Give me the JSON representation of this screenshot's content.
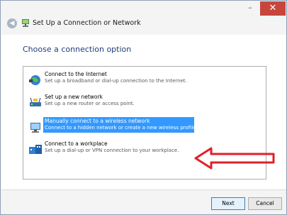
{
  "window": {
    "title": "Set Up a Connection or Network",
    "minimize_symbol": "–",
    "close_symbol": "✕"
  },
  "main": {
    "heading": "Choose a connection option",
    "options": [
      {
        "title": "Connect to the Internet",
        "description": "Set up a broadband or dial-up connection to the Internet.",
        "icon": "globe-network-icon"
      },
      {
        "title": "Set up a new network",
        "description": "Set up a new router or access point.",
        "icon": "router-icon"
      },
      {
        "title": "Manually connect to a wireless network",
        "description": "Connect to a hidden network or create a new wireless profile.",
        "icon": "wireless-computer-icon",
        "selected": true
      },
      {
        "title": "Connect to a workplace",
        "description": "Set up a dial-up or VPN connection to your workplace.",
        "icon": "workplace-icon"
      }
    ]
  },
  "footer": {
    "next_label": "Next",
    "cancel_label": "Cancel"
  },
  "colors": {
    "selection": "#3399ff",
    "close_button": "#c7463c",
    "annotation_arrow": "#e0202a",
    "heading": "#1f3f78"
  }
}
